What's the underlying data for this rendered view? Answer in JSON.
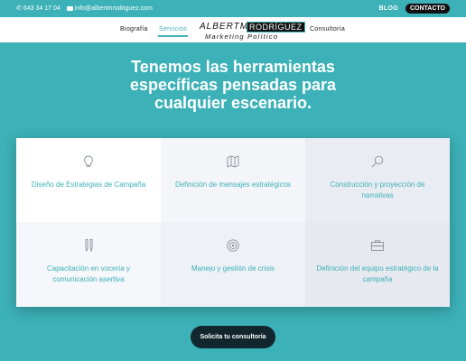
{
  "topbar": {
    "phone": "643 34 17 04",
    "email": "info@albertmrodriguez.com",
    "blog_label": "BLOG",
    "contact_label": "CONTACTO"
  },
  "nav": {
    "items": [
      {
        "label": "Biografía"
      },
      {
        "label": "Servicios"
      },
      {
        "label": "Consultoría"
      }
    ],
    "logo": {
      "name_first": "ALBERTM",
      "name_last": "RODRÍGUEZ",
      "tagline": "Marketing Político"
    }
  },
  "hero": {
    "line1": "Tenemos las herramientas",
    "line2": "específicas pensadas para",
    "line3": "cualquier escenario."
  },
  "services": [
    {
      "label": "Diseño de Estrategias de Campaña",
      "icon": "lightbulb-icon"
    },
    {
      "label": "Definición de mensajes estratégicos",
      "icon": "map-icon"
    },
    {
      "label": "Construcción y proyección de narrativas",
      "icon": "magnifier-icon"
    },
    {
      "label": "Capacitación en vocería y comunicación asertiva",
      "icon": "pencil-icon"
    },
    {
      "label": "Manejo y gestión de crisis",
      "icon": "target-icon"
    },
    {
      "label": "Definición del equipo estratégico de la campaña",
      "icon": "briefcase-icon"
    }
  ],
  "cta": {
    "label": "Solicita tu consultoría"
  },
  "colors": {
    "accent": "#3cb1b7",
    "dark": "#12262d"
  }
}
